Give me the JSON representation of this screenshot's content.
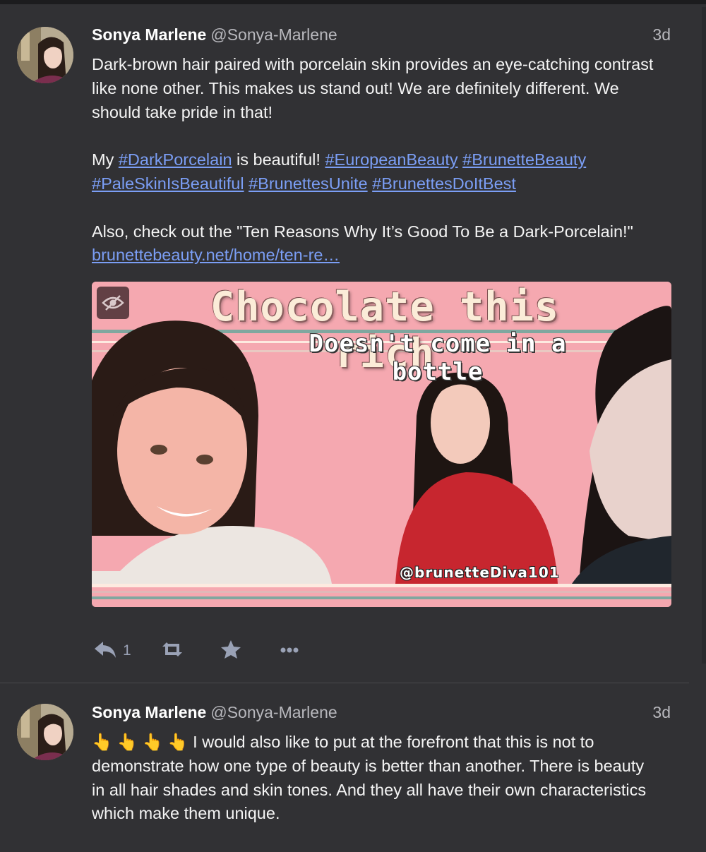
{
  "posts": [
    {
      "display_name": "Sonya Marlene",
      "handle": "@Sonya-Marlene",
      "time": "3d",
      "body": {
        "p1": "Dark-brown hair paired with porcelain skin provides an eye-catching contrast like none other. This makes us stand out!  We are definitely different. We should take pride in that!",
        "p2_a": "My ",
        "p2_b": " is beautiful! ",
        "hashtags": [
          "#DarkPorcelain",
          "#EuropeanBeauty",
          "#BrunetteBeauty",
          "#PaleSkinIsBeautiful",
          "#BrunettesUnite",
          "#BrunettesDoItBest"
        ],
        "p3": "Also, check out the \"Ten Reasons Why It’s Good To Be a Dark-Porcelain!\"",
        "link": "brunettebeauty.net/home/ten-re…"
      },
      "media": {
        "title": "Chocolate this rich",
        "subtitle": "Doesn't come in a bottle",
        "watermark": "@brunetteDiva101",
        "hide_icon": "eye-slash-icon"
      },
      "actions": {
        "reply_icon": "reply-icon",
        "reply_count": "1",
        "boost_icon": "retweet-icon",
        "favourite_icon": "star-icon",
        "more_icon": "ellipsis-icon"
      }
    },
    {
      "display_name": "Sonya Marlene",
      "handle": "@Sonya-Marlene",
      "time": "3d",
      "body": {
        "emoji": "👆 👆 👆 👆",
        "text": " I would also like to put at the forefront that this is not to demonstrate how one type of beauty is better than another. There is beauty in all hair shades and skin tones. And they all have their own characteristics which make them unique."
      }
    }
  ],
  "colors": {
    "background": "#313134",
    "link": "#7b9ef5",
    "muted": "#b8b8bd",
    "action_icon": "#9aa2b6",
    "media_pink": "#f5a8b0"
  }
}
